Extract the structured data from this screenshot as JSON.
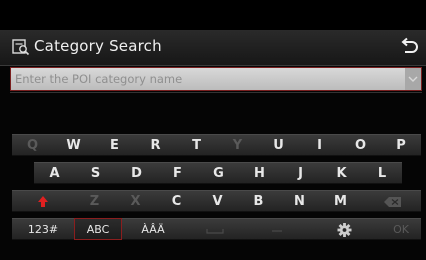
{
  "header": {
    "title": "Category Search",
    "title_icon": "category-search-icon",
    "back_icon": "back-arrow-icon"
  },
  "search": {
    "placeholder": "Enter the POI category name",
    "dropdown_icon": "chevron-down-icon"
  },
  "keyboard": {
    "row1": [
      "Q",
      "W",
      "E",
      "R",
      "T",
      "Y",
      "U",
      "I",
      "O",
      "P"
    ],
    "row2": [
      "A",
      "S",
      "D",
      "F",
      "G",
      "H",
      "J",
      "K",
      "L"
    ],
    "row3": [
      "Z",
      "X",
      "C",
      "V",
      "B",
      "N",
      "M"
    ],
    "shift_icon": "shift-up-arrow-icon",
    "delete_icon": "backspace-icon",
    "bottom": {
      "num_label": "123#",
      "abc_label": "ABC",
      "accent_label": "ÀÂÄ",
      "space_icon": "space-bar-icon",
      "dash_icon": "dash-icon",
      "settings_icon": "gear-icon",
      "ok_label": "OK"
    },
    "disabled": [
      "Q",
      "Y",
      "Z",
      "X"
    ]
  },
  "colors": {
    "accent_red": "#8b1e1e",
    "shift_red": "#e02020"
  }
}
